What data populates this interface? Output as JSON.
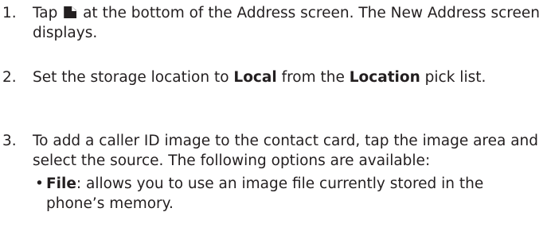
{
  "steps": [
    {
      "number": "1.",
      "text_before_icon": "Tap",
      "icon": "new-address-icon",
      "text_after_icon": " at the bottom of the Address screen. The New Address screen displays."
    },
    {
      "number": "2.",
      "text_1": "Set the storage location to ",
      "bold_1": "Local",
      "text_2": " from the ",
      "bold_2": "Location",
      "text_3": " pick list."
    },
    {
      "number": "3.",
      "text": "To add a caller ID image to the contact card, tap the image area and select the source. The following options are available:",
      "bullets": [
        {
          "marker": "•",
          "term": "File",
          "description": ": allows you to use an image file currently stored in the phone’s memory."
        }
      ]
    }
  ]
}
